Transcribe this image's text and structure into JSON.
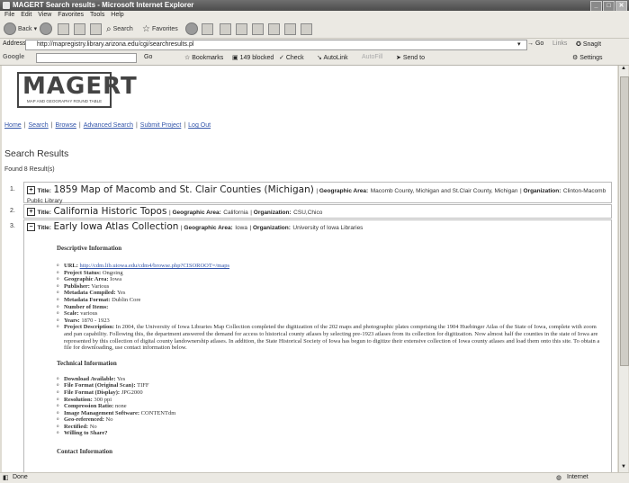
{
  "window": {
    "title": "MAGERT Search results - Microsoft Internet Explorer"
  },
  "menu": [
    "File",
    "Edit",
    "View",
    "Favorites",
    "Tools",
    "Help"
  ],
  "toolbar": {
    "back": "Back",
    "search": "Search",
    "favorites": "Favorites"
  },
  "address": {
    "label": "Address",
    "url": "http://mapregistry.library.arizona.edu/cgi/searchresults.pl",
    "go": "Go",
    "links": "Links",
    "snagit": "SnagIt"
  },
  "googlebar": {
    "label": "Google",
    "go": "Go",
    "bookmarks": "Bookmarks",
    "blocked": "149 blocked",
    "check": "Check",
    "autolink": "AutoLink",
    "autofill": "AutoFill",
    "sendto": "Send to",
    "settings": "Settings"
  },
  "logo": {
    "text": "MAGERT",
    "subtext": "MAP AND GEOGRAPHY ROUND TABLE"
  },
  "nav": [
    "Home",
    "Search",
    "Browse",
    "Advanced Search",
    "Submit Project",
    "Log Out"
  ],
  "results": {
    "heading": "Search Results",
    "count": "Found 8 Result(s)",
    "items": [
      {
        "num": "1.",
        "toggle": "+",
        "title_label": "Title:",
        "title": "1859 Map of Macomb and St. Clair Counties (Michigan)",
        "area_label": "Geographic Area:",
        "area": "Macomb County, Michigan and St.Clair County, Michigan",
        "org_label": "Organization:",
        "org": "Clinton-Macomb Public Library"
      },
      {
        "num": "2.",
        "toggle": "+",
        "title_label": "Title:",
        "title": "California Historic Topos",
        "area_label": "Geographic Area:",
        "area": "California",
        "org_label": "Organization:",
        "org": "CSU,Chico"
      },
      {
        "num": "3.",
        "toggle": "−",
        "title_label": "Title:",
        "title": "Early Iowa Atlas Collection",
        "area_label": "Geographic Area:",
        "area": "Iowa",
        "org_label": "Organization:",
        "org": "University of Iowa Libraries"
      }
    ]
  },
  "details": {
    "descriptive_heading": "Descriptive Information",
    "descriptive": [
      {
        "label": "URL:",
        "value": "http://cdm.lib.uiowa.edu/cdm4/browse.php?CISOROOT=/maps"
      },
      {
        "label": "Project Status:",
        "value": "Ongoing"
      },
      {
        "label": "Geographic Area:",
        "value": "Iowa"
      },
      {
        "label": "Publisher:",
        "value": "Various"
      },
      {
        "label": "Metadata Compiled:",
        "value": "Yes"
      },
      {
        "label": "Metadata Format:",
        "value": "Dublin Core"
      },
      {
        "label": "Number of Items:",
        "value": ""
      },
      {
        "label": "Scale:",
        "value": "various"
      },
      {
        "label": "Years:",
        "value": "1870 - 1923"
      }
    ],
    "project_description_label": "Project Description:",
    "project_description": "In 2004, the University of Iowa Libraries Map Collection completed the digitization of the 202 maps and photographic plates comprising the 1904 Huebinger Atlas of the State of Iowa, complete with zoom and pan capability. Following this, the department answered the demand for access to historical county atlases by selecting pre-1923 atlases from its collection for digitization. Now almost half the counties in the state of Iowa are represented by this collection of digital county landownership atlases. In addition, the State Historical Society of Iowa has begun to digitize their extensive collection of Iowa county atlases and load them onto this site. To obtain a file for downloading, use contact information below.",
    "technical_heading": "Technical Information",
    "technical": [
      {
        "label": "Download Available:",
        "value": "Yes"
      },
      {
        "label": "File Format (Original Scan):",
        "value": "TIFF"
      },
      {
        "label": "File Format (Display):",
        "value": "JPG2000"
      },
      {
        "label": "Resolution:",
        "value": "300 ppi"
      },
      {
        "label": "Compression Ratio:",
        "value": "none"
      },
      {
        "label": "Image Management Software:",
        "value": "CONTENTdm"
      },
      {
        "label": "Geo-referenced:",
        "value": "No"
      },
      {
        "label": "Rectified:",
        "value": "No"
      },
      {
        "label": "Willing to Share?",
        "value": ""
      }
    ],
    "contact_heading": "Contact Information"
  },
  "status": {
    "left": "Done",
    "zone": "Internet"
  },
  "colors": {
    "link": "#3355aa",
    "chrome": "#ebe9e3",
    "titlebar": "#5a5a5a"
  }
}
